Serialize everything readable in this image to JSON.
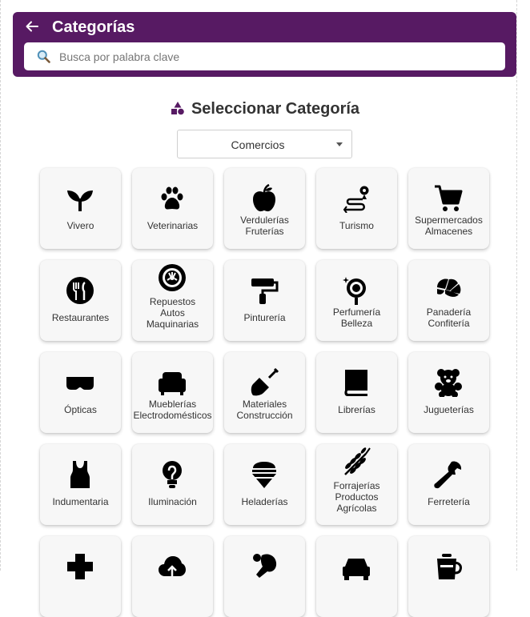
{
  "header": {
    "title": "Categorías",
    "search_placeholder": "Busca por palabra clave"
  },
  "section": {
    "title": "Seleccionar Categoría",
    "select_value": "Comercios"
  },
  "colors": {
    "header_bg": "#571a63",
    "card_bg": "#f7f7f7"
  },
  "categories": [
    {
      "label": "Vivero",
      "icon": "sprout-icon"
    },
    {
      "label": "Veterinarias",
      "icon": "paw-icon"
    },
    {
      "label": "Verdulerías\nFruterías",
      "icon": "apple-icon"
    },
    {
      "label": "Turismo",
      "icon": "route-icon"
    },
    {
      "label": "Supermercados\nAlmacenes",
      "icon": "shopping-cart-icon"
    },
    {
      "label": "Restaurantes",
      "icon": "restaurant-icon"
    },
    {
      "label": "Repuestos\nAutos\nMaquinarias",
      "icon": "tire-icon"
    },
    {
      "label": "Pinturería",
      "icon": "paint-roller-icon"
    },
    {
      "label": "Perfumería\nBelleza",
      "icon": "mirror-icon"
    },
    {
      "label": "Panadería\nConfitería",
      "icon": "croissant-icon"
    },
    {
      "label": "Ópticas",
      "icon": "glasses-icon"
    },
    {
      "label": "Mueblerías\nElectrodomésticos",
      "icon": "armchair-icon"
    },
    {
      "label": "Materiales\nConstrucción",
      "icon": "shovel-icon"
    },
    {
      "label": "Librerías",
      "icon": "book-icon"
    },
    {
      "label": "Jugueterías",
      "icon": "teddy-bear-icon"
    },
    {
      "label": "Indumentaria",
      "icon": "tank-top-icon"
    },
    {
      "label": "Iluminación",
      "icon": "lightbulb-icon"
    },
    {
      "label": "Heladerías",
      "icon": "ice-cream-icon"
    },
    {
      "label": "Forrajerías\nProductos\nAgrícolas",
      "icon": "wheat-icon"
    },
    {
      "label": "Ferretería",
      "icon": "wrench-icon"
    },
    {
      "label": "",
      "icon": "medical-cross-icon"
    },
    {
      "label": "",
      "icon": "cloud-upload-icon"
    },
    {
      "label": "",
      "icon": "ping-pong-icon"
    },
    {
      "label": "",
      "icon": "car-icon"
    },
    {
      "label": "",
      "icon": "takeaway-food-icon"
    }
  ]
}
